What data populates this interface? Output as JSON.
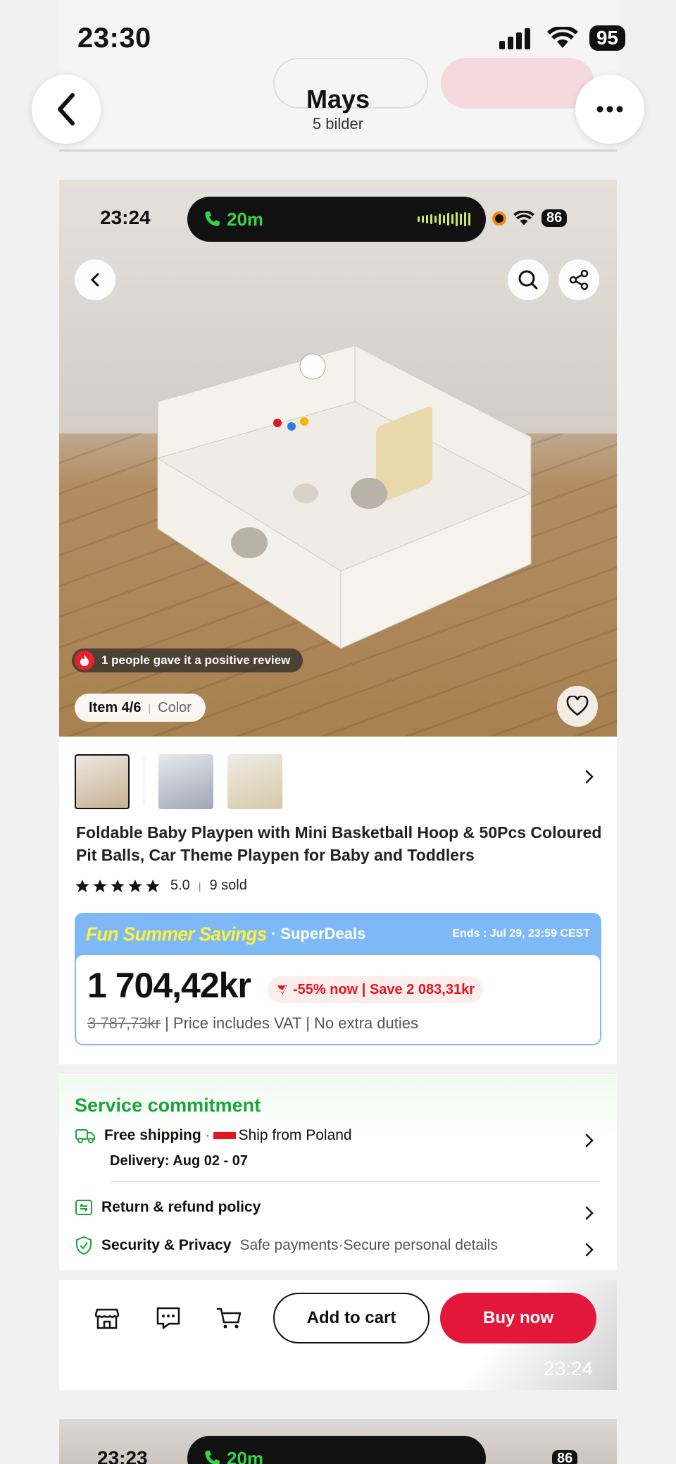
{
  "outer_status": {
    "time": "23:30",
    "battery": "95"
  },
  "header": {
    "title": "Mays",
    "subtitle": "5 bilder"
  },
  "inner_status": {
    "time": "23:24",
    "call_duration": "20m",
    "battery": "86"
  },
  "photo": {
    "review_text": "1 people gave it a positive review",
    "item_label": "Item 4/6",
    "color_label": "Color"
  },
  "product": {
    "title": "Foldable Baby Playpen with Mini Basketball Hoop & 50Pcs Coloured Pit Balls, Car Theme Playpen for Baby and Toddlers",
    "rating": "5.0",
    "rating_stars": 5,
    "sold": "9 sold"
  },
  "deal": {
    "fun_label": "Fun  Summer Savings",
    "super_label": "· SuperDeals",
    "ends": "Ends : Jul 29, 23:59 CEST",
    "price": "1 704,42kr",
    "discount": "-55% now | Save 2 083,31kr",
    "original_price": "3 787,73kr",
    "price_note": " | Price includes VAT | No extra duties"
  },
  "service": {
    "title": "Service commitment",
    "shipping_label": "Free shipping",
    "shipping_from": "Ship from Poland",
    "delivery": "Delivery: Aug 02 - 07",
    "return_label": "Return & refund policy",
    "security_label": "Security & Privacy",
    "security_detail": "Safe payments·Secure personal details"
  },
  "bottombar": {
    "add_to_cart": "Add to cart",
    "buy_now": "Buy now",
    "time": "23:24"
  },
  "next_card": {
    "time": "23:23",
    "call_duration": "20m",
    "battery": "86"
  },
  "colors": {
    "accent_red": "#e3173a",
    "service_green": "#1aa43a",
    "deal_blue": "#7eb8f7",
    "deal_yellow": "#fff33a"
  }
}
